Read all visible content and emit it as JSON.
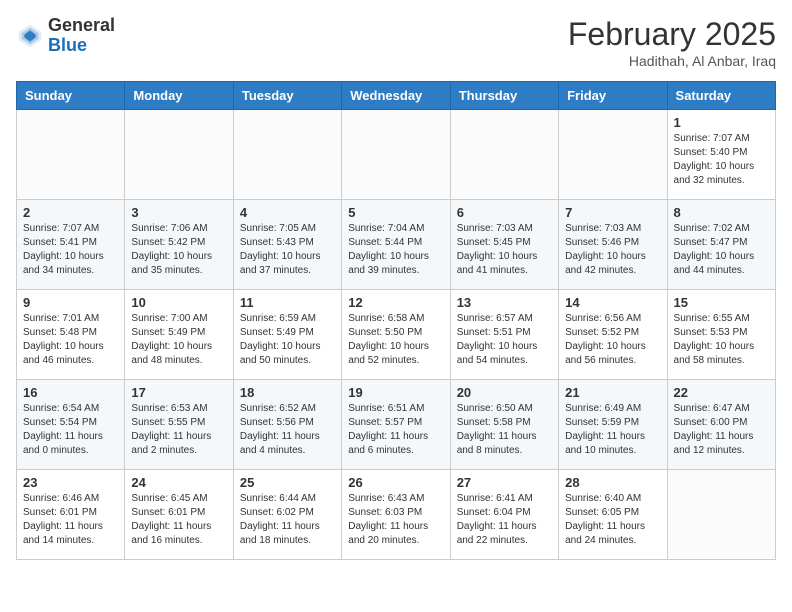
{
  "header": {
    "logo": {
      "line1": "General",
      "line2": "Blue"
    },
    "title": "February 2025",
    "location": "Hadithah, Al Anbar, Iraq"
  },
  "days_of_week": [
    "Sunday",
    "Monday",
    "Tuesday",
    "Wednesday",
    "Thursday",
    "Friday",
    "Saturday"
  ],
  "weeks": [
    [
      {
        "day": "",
        "info": ""
      },
      {
        "day": "",
        "info": ""
      },
      {
        "day": "",
        "info": ""
      },
      {
        "day": "",
        "info": ""
      },
      {
        "day": "",
        "info": ""
      },
      {
        "day": "",
        "info": ""
      },
      {
        "day": "1",
        "info": "Sunrise: 7:07 AM\nSunset: 5:40 PM\nDaylight: 10 hours\nand 32 minutes."
      }
    ],
    [
      {
        "day": "2",
        "info": "Sunrise: 7:07 AM\nSunset: 5:41 PM\nDaylight: 10 hours\nand 34 minutes."
      },
      {
        "day": "3",
        "info": "Sunrise: 7:06 AM\nSunset: 5:42 PM\nDaylight: 10 hours\nand 35 minutes."
      },
      {
        "day": "4",
        "info": "Sunrise: 7:05 AM\nSunset: 5:43 PM\nDaylight: 10 hours\nand 37 minutes."
      },
      {
        "day": "5",
        "info": "Sunrise: 7:04 AM\nSunset: 5:44 PM\nDaylight: 10 hours\nand 39 minutes."
      },
      {
        "day": "6",
        "info": "Sunrise: 7:03 AM\nSunset: 5:45 PM\nDaylight: 10 hours\nand 41 minutes."
      },
      {
        "day": "7",
        "info": "Sunrise: 7:03 AM\nSunset: 5:46 PM\nDaylight: 10 hours\nand 42 minutes."
      },
      {
        "day": "8",
        "info": "Sunrise: 7:02 AM\nSunset: 5:47 PM\nDaylight: 10 hours\nand 44 minutes."
      }
    ],
    [
      {
        "day": "9",
        "info": "Sunrise: 7:01 AM\nSunset: 5:48 PM\nDaylight: 10 hours\nand 46 minutes."
      },
      {
        "day": "10",
        "info": "Sunrise: 7:00 AM\nSunset: 5:49 PM\nDaylight: 10 hours\nand 48 minutes."
      },
      {
        "day": "11",
        "info": "Sunrise: 6:59 AM\nSunset: 5:49 PM\nDaylight: 10 hours\nand 50 minutes."
      },
      {
        "day": "12",
        "info": "Sunrise: 6:58 AM\nSunset: 5:50 PM\nDaylight: 10 hours\nand 52 minutes."
      },
      {
        "day": "13",
        "info": "Sunrise: 6:57 AM\nSunset: 5:51 PM\nDaylight: 10 hours\nand 54 minutes."
      },
      {
        "day": "14",
        "info": "Sunrise: 6:56 AM\nSunset: 5:52 PM\nDaylight: 10 hours\nand 56 minutes."
      },
      {
        "day": "15",
        "info": "Sunrise: 6:55 AM\nSunset: 5:53 PM\nDaylight: 10 hours\nand 58 minutes."
      }
    ],
    [
      {
        "day": "16",
        "info": "Sunrise: 6:54 AM\nSunset: 5:54 PM\nDaylight: 11 hours\nand 0 minutes."
      },
      {
        "day": "17",
        "info": "Sunrise: 6:53 AM\nSunset: 5:55 PM\nDaylight: 11 hours\nand 2 minutes."
      },
      {
        "day": "18",
        "info": "Sunrise: 6:52 AM\nSunset: 5:56 PM\nDaylight: 11 hours\nand 4 minutes."
      },
      {
        "day": "19",
        "info": "Sunrise: 6:51 AM\nSunset: 5:57 PM\nDaylight: 11 hours\nand 6 minutes."
      },
      {
        "day": "20",
        "info": "Sunrise: 6:50 AM\nSunset: 5:58 PM\nDaylight: 11 hours\nand 8 minutes."
      },
      {
        "day": "21",
        "info": "Sunrise: 6:49 AM\nSunset: 5:59 PM\nDaylight: 11 hours\nand 10 minutes."
      },
      {
        "day": "22",
        "info": "Sunrise: 6:47 AM\nSunset: 6:00 PM\nDaylight: 11 hours\nand 12 minutes."
      }
    ],
    [
      {
        "day": "23",
        "info": "Sunrise: 6:46 AM\nSunset: 6:01 PM\nDaylight: 11 hours\nand 14 minutes."
      },
      {
        "day": "24",
        "info": "Sunrise: 6:45 AM\nSunset: 6:01 PM\nDaylight: 11 hours\nand 16 minutes."
      },
      {
        "day": "25",
        "info": "Sunrise: 6:44 AM\nSunset: 6:02 PM\nDaylight: 11 hours\nand 18 minutes."
      },
      {
        "day": "26",
        "info": "Sunrise: 6:43 AM\nSunset: 6:03 PM\nDaylight: 11 hours\nand 20 minutes."
      },
      {
        "day": "27",
        "info": "Sunrise: 6:41 AM\nSunset: 6:04 PM\nDaylight: 11 hours\nand 22 minutes."
      },
      {
        "day": "28",
        "info": "Sunrise: 6:40 AM\nSunset: 6:05 PM\nDaylight: 11 hours\nand 24 minutes."
      },
      {
        "day": "",
        "info": ""
      }
    ]
  ]
}
